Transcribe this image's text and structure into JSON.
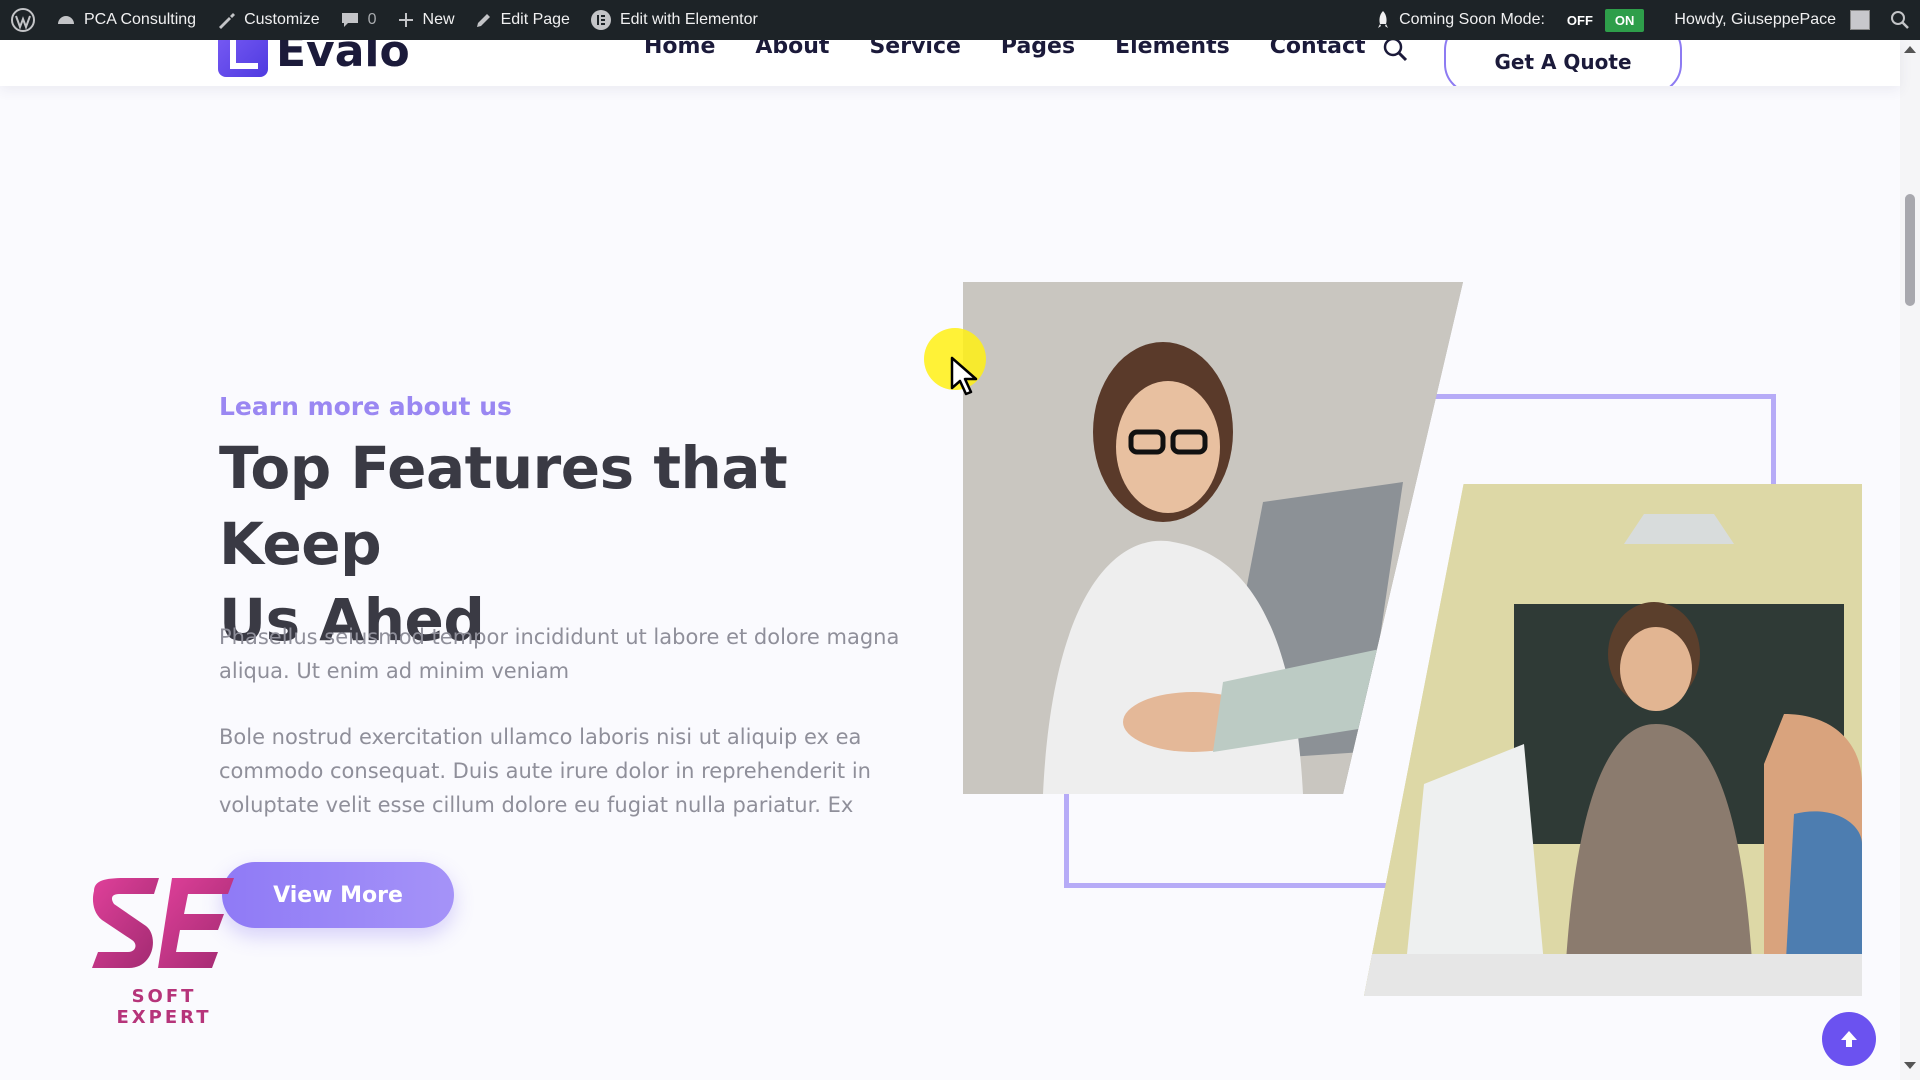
{
  "admin_bar": {
    "site_name": "PCA Consulting",
    "customize": "Customize",
    "comments_count": "0",
    "new": "New",
    "edit_page": "Edit Page",
    "edit_elementor": "Edit with Elementor",
    "coming_soon_label": "Coming Soon Mode:",
    "coming_soon_off": "OFF",
    "coming_soon_on": "ON",
    "howdy": "Howdy, GiuseppePace"
  },
  "header": {
    "logo_text": "Evalo",
    "nav": [
      "Home",
      "About",
      "Service",
      "Pages",
      "Elements",
      "Contact"
    ],
    "quote_button": "Get A Quote"
  },
  "hero": {
    "eyebrow": "Learn more about us",
    "headline_line1": "Top Features that Keep",
    "headline_line2": "Us Ahed",
    "paragraph1": "Phasellus seiusmod tempor incididunt ut labore et dolore magna aliqua. Ut enim ad minim veniam",
    "paragraph2": "Bole nostrud exercitation ullamco laboris nisi ut aliquip ex ea commodo consequat. Duis aute irure dolor in reprehenderit in voluptate velit esse cillum dolore eu fugiat nulla pariatur. Ex",
    "button": "View More"
  },
  "watermark": {
    "text": "SOFT EXPERT"
  },
  "colors": {
    "accent": "#8f7af6",
    "admin_bar": "#1d2327",
    "toggle_on": "#2e9e4a",
    "heading": "#3a3a44",
    "eyebrow": "#9a87f2"
  },
  "icons": [
    "wordpress-icon",
    "dashboard-icon",
    "brush-icon",
    "comment-icon",
    "plus-icon",
    "pencil-icon",
    "elementor-icon",
    "rocket-icon",
    "search-icon",
    "arrow-up-icon"
  ]
}
